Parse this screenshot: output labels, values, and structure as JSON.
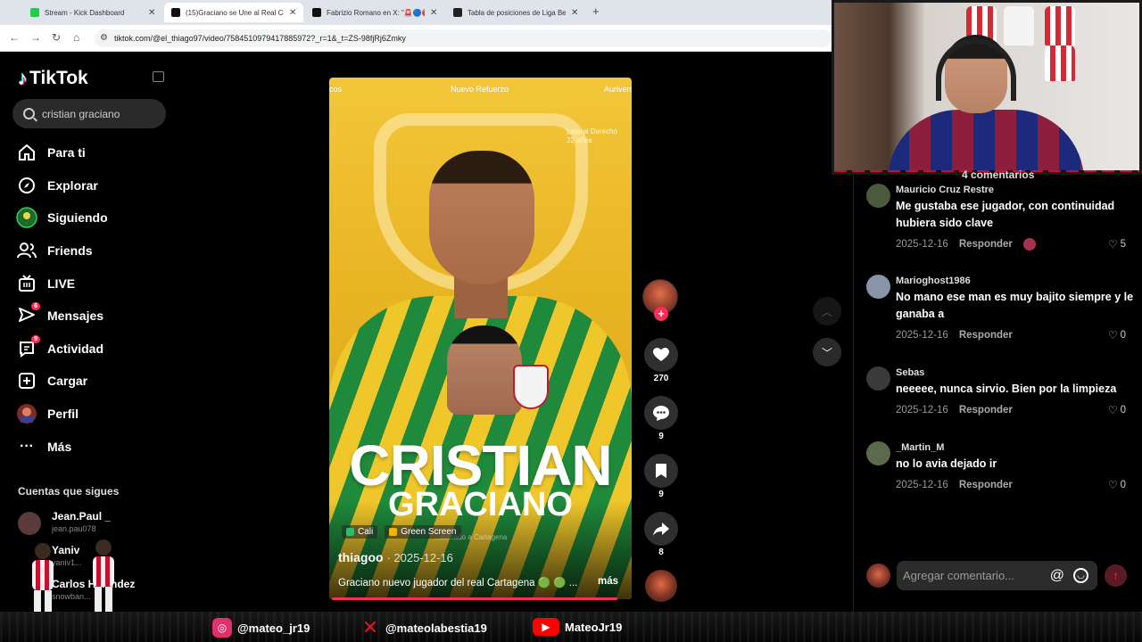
{
  "browser": {
    "tabs": [
      {
        "label": "Stream - Kick Dashboard",
        "active": false,
        "favicon_color": "#1fcf4b"
      },
      {
        "label": "(15)Graciano se Une al Real Car",
        "active": true,
        "favicon_color": "#111111"
      },
      {
        "label": "Fabrizio Romano en X: \"🚨🔵🔴",
        "active": false,
        "favicon_color": "#111111"
      },
      {
        "label": "Tabla de posiciones de Liga Bet",
        "active": false,
        "favicon_color": "#222222"
      }
    ],
    "url": "tiktok.com/@el_thiago97/video/7584510979417885972?_r=1&_t=ZS-98fjRj6Zmky"
  },
  "sidebar": {
    "logo": "TikTok",
    "search_value": "cristian graciano",
    "nav": [
      {
        "label": "Para ti",
        "icon": "home-icon",
        "badge": ""
      },
      {
        "label": "Explorar",
        "icon": "compass-icon",
        "badge": ""
      },
      {
        "label": "Siguiendo",
        "icon": "following-avatar-icon",
        "badge": ""
      },
      {
        "label": "Friends",
        "icon": "friends-icon",
        "badge": ""
      },
      {
        "label": "LIVE",
        "icon": "live-icon",
        "badge": ""
      },
      {
        "label": "Mensajes",
        "icon": "messages-icon",
        "badge": "6"
      },
      {
        "label": "Actividad",
        "icon": "activity-icon",
        "badge": "9"
      },
      {
        "label": "Cargar",
        "icon": "upload-icon",
        "badge": ""
      },
      {
        "label": "Perfil",
        "icon": "profile-avatar-icon",
        "badge": ""
      },
      {
        "label": "Más",
        "icon": "more-icon",
        "badge": ""
      }
    ],
    "following_title": "Cuentas que sigues",
    "following": [
      {
        "name": "Jean.Paul _",
        "handle": "jean.pau078"
      },
      {
        "name": "Yaniv",
        "handle": "yaniv1..."
      },
      {
        "name": "Carlos He...ndez",
        "handle": "snowban..."
      }
    ]
  },
  "video": {
    "top_labels": [
      "cos",
      "Nuevo Refuerzo",
      "Aurivero"
    ],
    "lateral_line1": "Lateral Derecho",
    "lateral_line2": "22 años",
    "title_line1": "CRISTIAN",
    "title_line2": "GRACIANO",
    "tags": [
      "Cali",
      "Green Screen"
    ],
    "tag_ghost": "...sumado a Cartagena",
    "author": "thiagoo",
    "date": "· 2025-12-16",
    "caption": "Graciano nuevo jugador del real Cartagena 🟢 🟢 ...",
    "more": "más",
    "progress": 0.97
  },
  "actions": {
    "likes": "270",
    "comments": "9",
    "saves": "9",
    "shares": "8"
  },
  "comments_panel": {
    "count_label": "4 comentarios",
    "reply_label": "Responder",
    "items": [
      {
        "user": "Mauricio Cruz Restre",
        "text": "Me gustaba ese jugador, con continuidad hubiera sido clave",
        "date": "2025-12-16",
        "likes": "5",
        "avatar_color": "#4a5a3a"
      },
      {
        "user": "Marioghost1986",
        "text": "No mano ese man es muy bajito siempre y le ganaba a",
        "date": "2025-12-16",
        "likes": "0",
        "avatar_color": "#8a94a8"
      },
      {
        "user": "Sebas",
        "text": "neeeee, nunca sirvio. Bien por la limpieza",
        "date": "2025-12-16",
        "likes": "0",
        "avatar_color": "#3a3a3a"
      },
      {
        "user": "_Martin_M",
        "text": "no lo avia dejado ir",
        "date": "2025-12-16",
        "likes": "0",
        "avatar_color": "#5a6a4a"
      }
    ],
    "input_placeholder": "Agregar comentario..."
  },
  "banner": {
    "instagram": "@mateo_jr19",
    "x": "@mateolabestia19",
    "youtube": "MateoJr19"
  },
  "colors": {
    "accent": "#fe2c55",
    "instagram": "#e1306c",
    "youtube": "#ff0000",
    "x": "#e0141e"
  }
}
